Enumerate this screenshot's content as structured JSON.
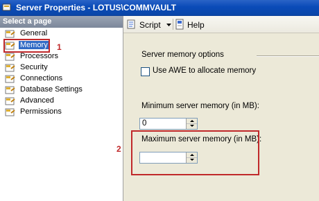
{
  "window": {
    "title": "Server Properties - LOTUS\\COMMVAULT"
  },
  "left_pane": {
    "header": "Select a page",
    "items": [
      {
        "label": "General",
        "selected": false
      },
      {
        "label": "Memory",
        "selected": true
      },
      {
        "label": "Processors",
        "selected": false
      },
      {
        "label": "Security",
        "selected": false
      },
      {
        "label": "Connections",
        "selected": false
      },
      {
        "label": "Database Settings",
        "selected": false
      },
      {
        "label": "Advanced",
        "selected": false
      },
      {
        "label": "Permissions",
        "selected": false
      }
    ]
  },
  "toolbar": {
    "script_label": "Script",
    "help_label": "Help"
  },
  "main": {
    "section_label": "Server memory options",
    "awe_checkbox": {
      "label": "Use AWE to allocate memory",
      "checked": false
    },
    "min_memory": {
      "label": "Minimum server memory (in MB):",
      "value": "0"
    },
    "max_memory": {
      "label": "Maximum server memory (in MB):",
      "value": ""
    }
  },
  "annotations": {
    "callout_1": "1",
    "callout_2": "2",
    "highlight_color": "#c0282a"
  },
  "colors": {
    "titlebar": "#0a4bb8",
    "selection": "#316ac5"
  }
}
